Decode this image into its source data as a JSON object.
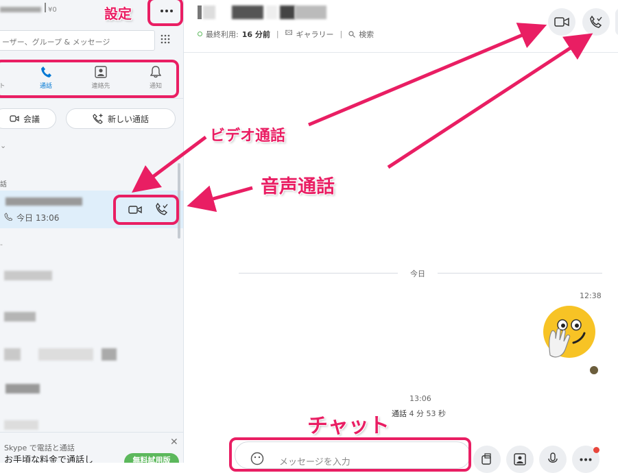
{
  "sidebar": {
    "balance": "¥0",
    "search_placeholder": "ーザー、グループ & メッセージ",
    "tabs": [
      {
        "label": "ト"
      },
      {
        "label": "通話"
      },
      {
        "label": "連絡先"
      },
      {
        "label": "通知"
      }
    ],
    "meeting_button": "会議",
    "new_call_button": "新しい通話",
    "section_label": "話",
    "active_item": {
      "time": "今日 13:06"
    },
    "promo": {
      "title": "Skype で電話と通話",
      "body": "お手頃な料金で通話し",
      "cta": "無料試用版"
    }
  },
  "header": {
    "last_seen_label": "最終利用:",
    "last_seen_value": "16 分前",
    "gallery": "ギャラリー",
    "search": "検索"
  },
  "chat": {
    "date_divider": "今日",
    "time_1": "12:38",
    "time_2": "13:06",
    "call_label": "通話",
    "call_duration": "4 分 53 秒",
    "input_placeholder": "メッセージを入力"
  },
  "annotations": {
    "settings": "設定",
    "video_call": "ビデオ通話",
    "voice_call": "音声通話",
    "chat": "チャット"
  },
  "colors": {
    "accent": "#0078d4",
    "annotation": "#e91e63",
    "status_green": "#5cb85c"
  }
}
